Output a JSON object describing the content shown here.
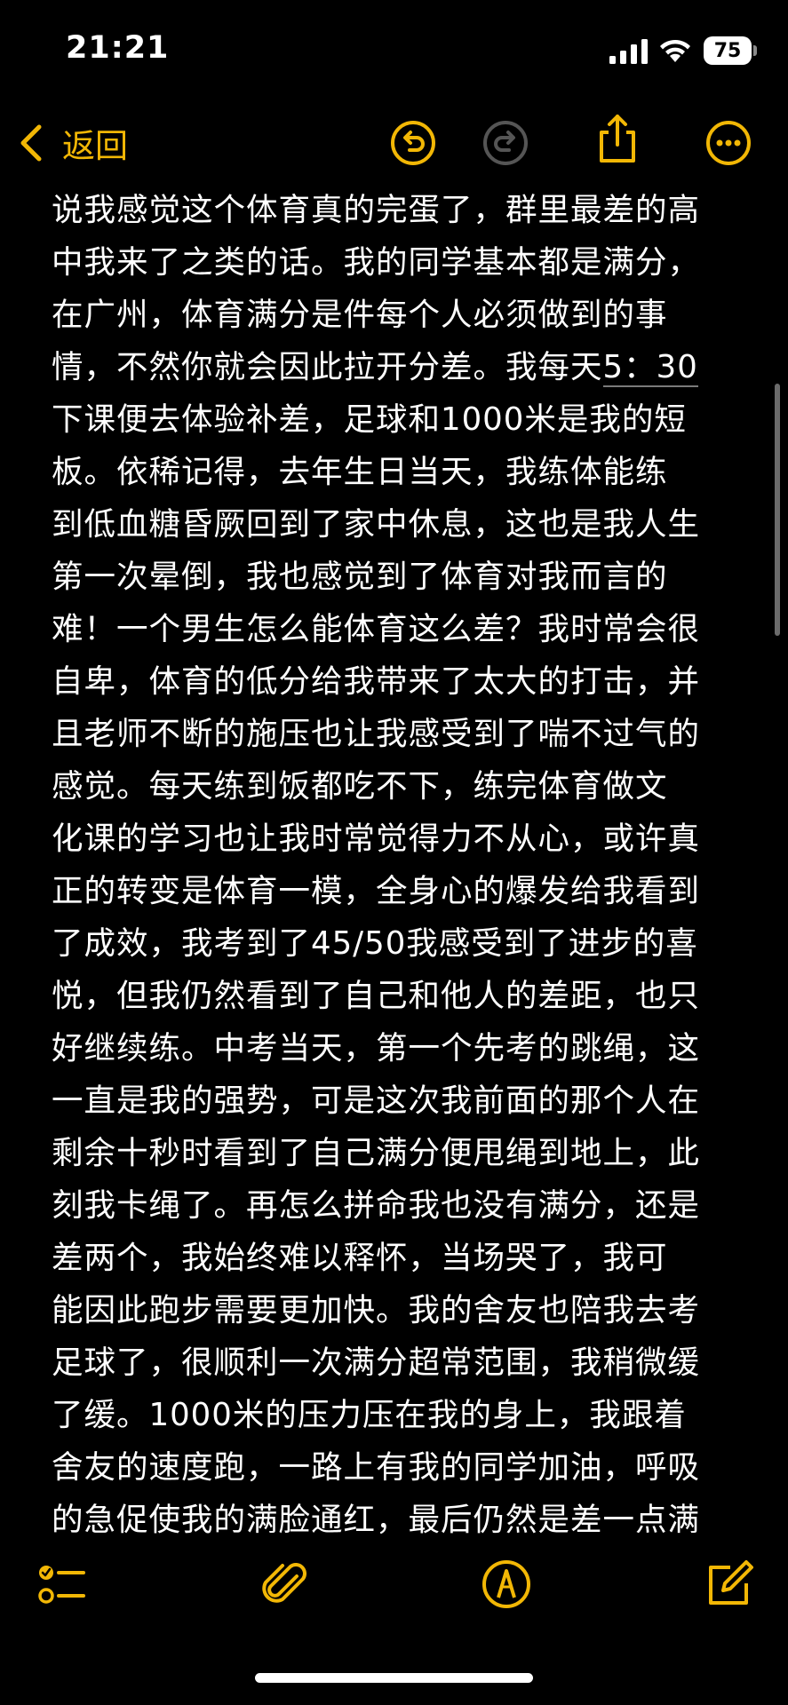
{
  "status_bar": {
    "time": "21:21",
    "battery": "75",
    "icons": [
      "signal-icon",
      "wifi-icon",
      "battery-icon"
    ]
  },
  "nav": {
    "back_label": "返回",
    "icons": [
      "chevron-left-icon",
      "undo-icon",
      "redo-icon",
      "share-icon",
      "more-icon"
    ],
    "accent_color": "#F2B705"
  },
  "note": {
    "lines": [
      "说我感觉这个体育真的完蛋了，群里最差的高",
      "中我来了之类的话。我的同学基本都是满分，",
      "在广州，体育满分是件每个人必须做到的事",
      "情，不然你就会因此拉开分差。我每天",
      "下课便去体验补差，足球和1000米是我的短",
      "板。依稀记得，去年生日当天，我练体能练",
      "到低血糖昏厥回到了家中休息，这也是我人生",
      "第一次晕倒，我也感觉到了体育对我而言的",
      "难！一个男生怎么能体育这么差？我时常会很",
      "自卑，体育的低分给我带来了太大的打击，并",
      "且老师不断的施压也让我感受到了喘不过气的",
      "感觉。每天练到饭都吃不下，练完体育做文",
      "化课的学习也让我时常觉得力不从心，或许真",
      "正的转变是体育一模，全身心的爆发给我看到",
      "了成效，我考到了45/50我感受到了进步的喜",
      "悦，但我仍然看到了自己和他人的差距，也只",
      "好继续练。中考当天，第一个先考的跳绳，这",
      "一直是我的强势，可是这次我前面的那个人在",
      "剩余十秒时看到了自己满分便甩绳到地上，此",
      "刻我卡绳了。再怎么拼命我也没有满分，还是",
      "差两个，我始终难以释怀，当场哭了，我可",
      "能因此跑步需要更加快。我的舍友也陪我去考",
      "足球了，很顺利一次满分超常范围，我稍微缓",
      "了缓。1000米的压力压在我的身上，我跟着",
      "舍友的速度跑，一路上有我的同学加油，呼吸",
      "的急促使我的满脸通红，最后仍然是差一点满"
    ],
    "line4_time": "5：30"
  },
  "toolbar": {
    "icons": [
      "checklist-icon",
      "paperclip-icon",
      "markup-pen-icon",
      "compose-icon"
    ]
  }
}
